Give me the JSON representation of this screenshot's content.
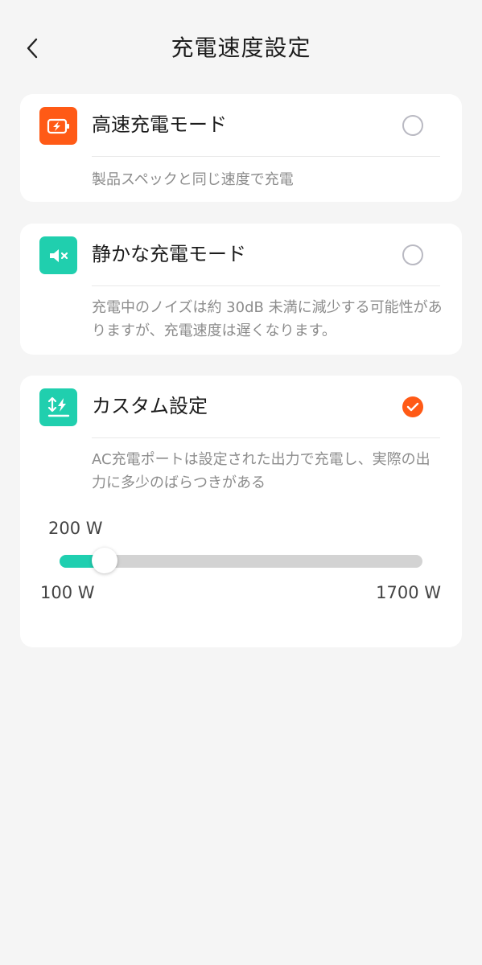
{
  "header": {
    "title": "充電速度設定"
  },
  "colors": {
    "accent": "#ff5a16",
    "teal": "#1fcfb0",
    "fast_icon_bg": "#ff5a16",
    "quiet_icon_bg": "#20cfae",
    "custom_icon_bg": "#20cfae"
  },
  "options": [
    {
      "title": "高速充電モード",
      "description": "製品スペックと同じ速度で充電",
      "icon": "lightning-battery-icon",
      "selected": false
    },
    {
      "title": "静かな充電モード",
      "description": "充電中のノイズは約 30dB 未満に減少する可能性がありますが、充電速度は遅くなります。",
      "icon": "mute-speaker-icon",
      "selected": false
    },
    {
      "title": "カスタム設定",
      "description": "AC充電ポートは設定された出力で充電し、実際の出力に多少のばらつきがある",
      "icon": "custom-power-icon",
      "selected": true
    }
  ],
  "slider": {
    "value_label": "200 W",
    "min_label": "100 W",
    "max_label": "1700 W",
    "value": 200,
    "min": 100,
    "max": 1700
  }
}
